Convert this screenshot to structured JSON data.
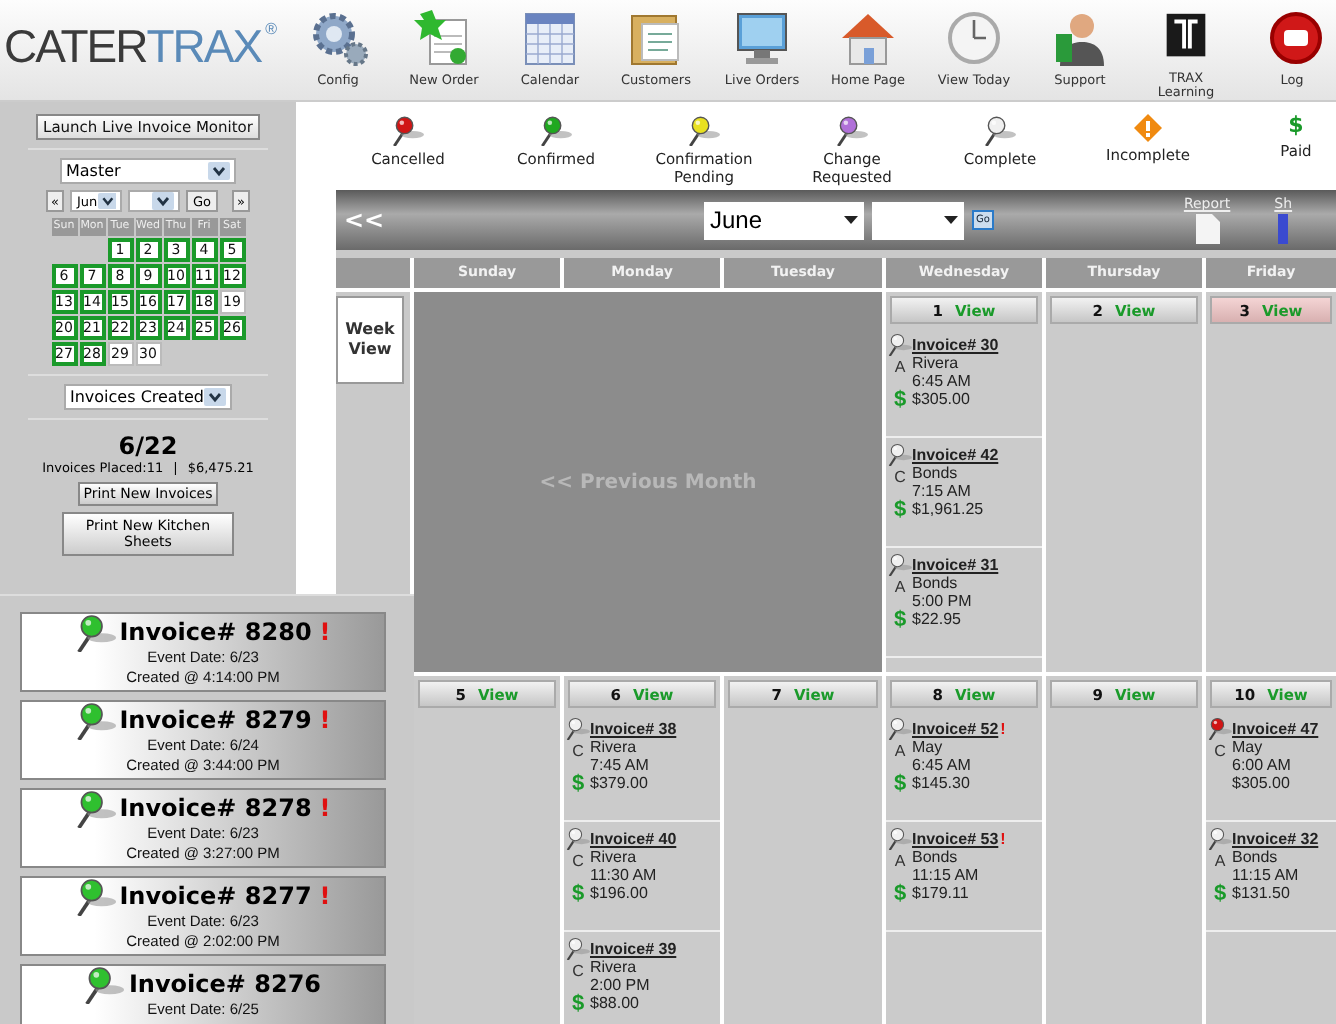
{
  "logo": {
    "first": "CATER",
    "second": "TRAX",
    "mark": "®"
  },
  "nav": [
    {
      "label": "Config"
    },
    {
      "label": "New Order"
    },
    {
      "label": "Calendar"
    },
    {
      "label": "Customers"
    },
    {
      "label": "Live Orders"
    },
    {
      "label": "Home Page"
    },
    {
      "label": "View Today"
    },
    {
      "label": "Support"
    },
    {
      "label": "TRAX Learning"
    },
    {
      "label": "Log"
    }
  ],
  "legend": [
    {
      "label": "Cancelled",
      "kind": "pin",
      "color": "#d01515"
    },
    {
      "label": "Confirmed",
      "kind": "pin",
      "color": "#1fa81f"
    },
    {
      "label": "Confirmation Pending",
      "kind": "pin",
      "color": "#e8e020"
    },
    {
      "label": "Change Requested",
      "kind": "pin",
      "color": "#b070d8"
    },
    {
      "label": "Complete",
      "kind": "pin",
      "color": "#f0f0f0"
    },
    {
      "label": "Incomplete",
      "kind": "diamond",
      "color": "#f08a10"
    },
    {
      "label": "Paid",
      "kind": "dollar",
      "symbol": "$",
      "color": "#1a9a2a"
    }
  ],
  "sidebar": {
    "monitor_button": "Launch Live Invoice Monitor",
    "calendar_select": "Master",
    "mini_calendar": {
      "prev": "«",
      "month": "Jun",
      "go": "Go",
      "next": "»",
      "weekdays": [
        "Sun",
        "Mon",
        "Tue",
        "Wed",
        "Thu",
        "Fri",
        "Sat"
      ],
      "weeks": [
        [
          {
            "kind": "blank"
          },
          {
            "kind": "blank"
          },
          {
            "day": "1",
            "marked": true
          },
          {
            "day": "2",
            "marked": true
          },
          {
            "day": "3",
            "marked": true
          },
          {
            "day": "4",
            "marked": true
          },
          {
            "day": "5",
            "marked": true
          }
        ],
        [
          {
            "day": "6",
            "marked": true
          },
          {
            "day": "7",
            "marked": true
          },
          {
            "day": "8",
            "marked": true
          },
          {
            "day": "9",
            "marked": true
          },
          {
            "day": "10",
            "marked": true
          },
          {
            "day": "11",
            "marked": true
          },
          {
            "day": "12",
            "marked": true
          }
        ],
        [
          {
            "day": "13",
            "marked": true
          },
          {
            "day": "14",
            "marked": true
          },
          {
            "day": "15",
            "marked": true
          },
          {
            "day": "16",
            "marked": true
          },
          {
            "day": "17",
            "marked": true
          },
          {
            "day": "18",
            "marked": true
          },
          {
            "day": "19",
            "marked": false
          }
        ],
        [
          {
            "day": "20",
            "marked": true
          },
          {
            "day": "21",
            "marked": true
          },
          {
            "day": "22",
            "marked": true
          },
          {
            "day": "23",
            "marked": true
          },
          {
            "day": "24",
            "marked": true
          },
          {
            "day": "25",
            "marked": true
          },
          {
            "day": "26",
            "marked": true
          }
        ],
        [
          {
            "day": "27",
            "marked": true
          },
          {
            "day": "28",
            "marked": true
          },
          {
            "day": "29",
            "marked": false
          },
          {
            "day": "30",
            "marked": false
          }
        ]
      ]
    },
    "report_select": "Invoices Created",
    "date": "6/22",
    "placed": "Invoices Placed:11",
    "separator": "|",
    "total": "$6,475.21",
    "buttons": [
      "Print New Invoices",
      "Print New Kitchen Sheets"
    ]
  },
  "toolbar": {
    "back": "<<",
    "month": "June",
    "go": "Go",
    "report": "Report",
    "cut_link": "Sh"
  },
  "calendar": {
    "weekdays": [
      "Sunday",
      "Monday",
      "Tuesday",
      "Wednesday",
      "Thursday",
      "Friday"
    ],
    "week_view": "Week View",
    "weeks": [
      {
        "previous_month": "<< Previous Month",
        "days": [
          {
            "date": "1",
            "view": "View",
            "highlighted": false,
            "invoices": [
              {
                "number": "Invoice# 30",
                "color": "#f0f0f0",
                "code": "A",
                "customer": "Rivera",
                "time": "6:45 AM",
                "amount": "$305.00",
                "paid": "$"
              },
              {
                "number": "Invoice# 42",
                "color": "#f0f0f0",
                "code": "C",
                "customer": "Bonds",
                "time": "7:15 AM",
                "amount": "$1,961.25",
                "paid": "$"
              },
              {
                "number": "Invoice# 31",
                "color": "#f0f0f0",
                "code": "A",
                "customer": "Bonds",
                "time": "5:00 PM",
                "amount": "$22.95",
                "paid": "$"
              }
            ]
          },
          {
            "date": "2",
            "view": "View",
            "highlighted": false
          },
          {
            "date": "3",
            "view": "View",
            "highlighted": true
          }
        ]
      },
      {
        "days": [
          {
            "date": "5",
            "view": "View",
            "highlighted": false
          },
          {
            "date": "6",
            "view": "View",
            "highlighted": false,
            "invoices": [
              {
                "number": "Invoice# 38",
                "color": "#f0f0f0",
                "code": "C",
                "customer": "Rivera",
                "time": "7:45 AM",
                "amount": "$379.00",
                "paid": "$"
              },
              {
                "number": "Invoice# 40",
                "color": "#f0f0f0",
                "code": "C",
                "customer": "Rivera",
                "time": "11:30 AM",
                "amount": "$196.00",
                "paid": "$"
              },
              {
                "number": "Invoice# 39",
                "color": "#f0f0f0",
                "code": "C",
                "customer": "Rivera",
                "time": "2:00 PM",
                "amount": "$88.00",
                "paid": "$"
              }
            ]
          },
          {
            "date": "7",
            "view": "View",
            "highlighted": false
          },
          {
            "date": "8",
            "view": "View",
            "highlighted": false,
            "invoices": [
              {
                "number": "Invoice# 52",
                "flag": "!",
                "color": "#f0f0f0",
                "code": "A",
                "customer": "May",
                "time": "6:45 AM",
                "amount": "$145.30",
                "paid": "$"
              },
              {
                "number": "Invoice# 53",
                "flag": "!",
                "color": "#f0f0f0",
                "code": "A",
                "customer": "Bonds",
                "time": "11:15 AM",
                "amount": "$179.11",
                "paid": "$"
              }
            ]
          },
          {
            "date": "9",
            "view": "View",
            "highlighted": false
          },
          {
            "date": "10",
            "view": "View",
            "highlighted": false,
            "invoices": [
              {
                "number": "Invoice# 47",
                "color": "#d01515",
                "code": "C",
                "customer": "May",
                "time": "6:00 AM",
                "amount": "$305.00"
              },
              {
                "number": "Invoice# 32",
                "color": "#f0f0f0",
                "code": "A",
                "customer": "Bonds",
                "time": "11:15 AM",
                "amount": "$131.50",
                "paid": "$"
              }
            ]
          }
        ]
      }
    ]
  },
  "recent_invoices": [
    {
      "title": "Invoice# 8280",
      "flag": "!",
      "event": "Event Date: 6/23",
      "created": "Created @ 4:14:00 PM"
    },
    {
      "title": "Invoice# 8279",
      "flag": "!",
      "event": "Event Date: 6/24",
      "created": "Created @ 3:44:00 PM"
    },
    {
      "title": "Invoice# 8278",
      "flag": "!",
      "event": "Event Date: 6/23",
      "created": "Created @ 3:27:00 PM"
    },
    {
      "title": "Invoice# 8277",
      "flag": "!",
      "event": "Event Date: 6/23",
      "created": "Created @ 2:02:00 PM"
    },
    {
      "title": "Invoice# 8276",
      "event": "Event Date: 6/25"
    }
  ]
}
